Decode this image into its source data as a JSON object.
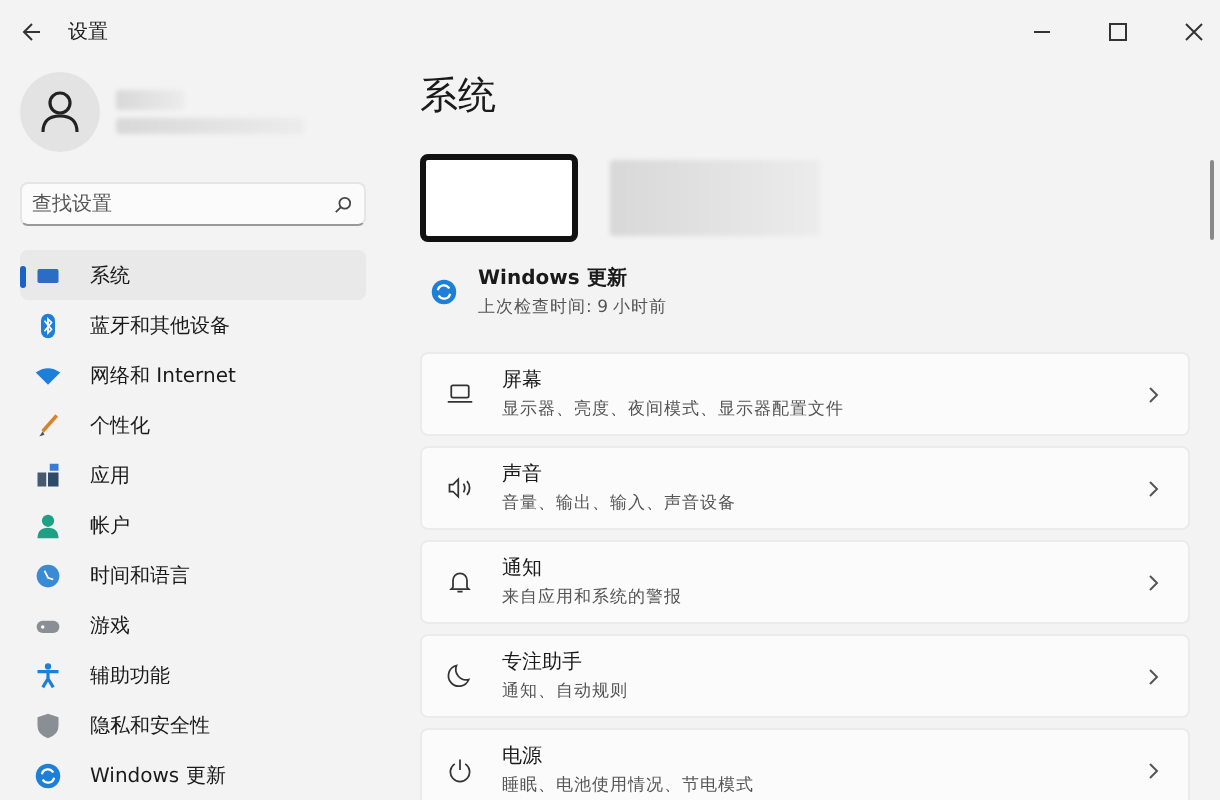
{
  "window": {
    "title": "设置"
  },
  "search": {
    "placeholder": "查找设置"
  },
  "nav": [
    {
      "label": "系统",
      "selected": true
    },
    {
      "label": "蓝牙和其他设备",
      "selected": false
    },
    {
      "label": "网络和 Internet",
      "selected": false
    },
    {
      "label": "个性化",
      "selected": false
    },
    {
      "label": "应用",
      "selected": false
    },
    {
      "label": "帐户",
      "selected": false
    },
    {
      "label": "时间和语言",
      "selected": false
    },
    {
      "label": "游戏",
      "selected": false
    },
    {
      "label": "辅助功能",
      "selected": false
    },
    {
      "label": "隐私和安全性",
      "selected": false
    },
    {
      "label": "Windows 更新",
      "selected": false
    }
  ],
  "page_title": "系统",
  "update": {
    "title": "Windows 更新",
    "subtitle": "上次检查时间: 9 小时前"
  },
  "cards": [
    {
      "title": "屏幕",
      "subtitle": "显示器、亮度、夜间模式、显示器配置文件"
    },
    {
      "title": "声音",
      "subtitle": "音量、输出、输入、声音设备"
    },
    {
      "title": "通知",
      "subtitle": "来自应用和系统的警报"
    },
    {
      "title": "专注助手",
      "subtitle": "通知、自动规则"
    },
    {
      "title": "电源",
      "subtitle": "睡眠、电池使用情况、节电模式"
    }
  ]
}
